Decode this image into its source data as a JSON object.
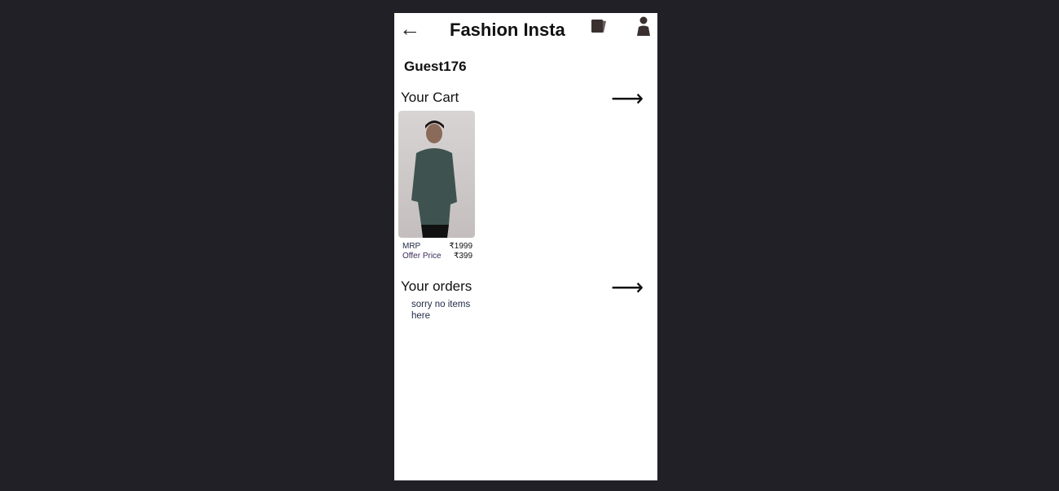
{
  "header": {
    "title": "Fashion Insta",
    "back_icon": "arrow-left-icon",
    "cards_icon": "cards-icon",
    "user_icon": "person-icon"
  },
  "user": {
    "name": "Guest176"
  },
  "cart": {
    "title": "Your Cart",
    "items": [
      {
        "image": "man in green checked shirt",
        "mrp_label": "MRP",
        "mrp": "₹1999",
        "offer_label": "Offer Price",
        "offer": "₹399"
      }
    ]
  },
  "orders": {
    "title": "Your orders",
    "empty_text": "sorry no items here"
  },
  "colors": {
    "background": "#212026",
    "panel": "#ffffff",
    "icon": "#3a3030"
  }
}
